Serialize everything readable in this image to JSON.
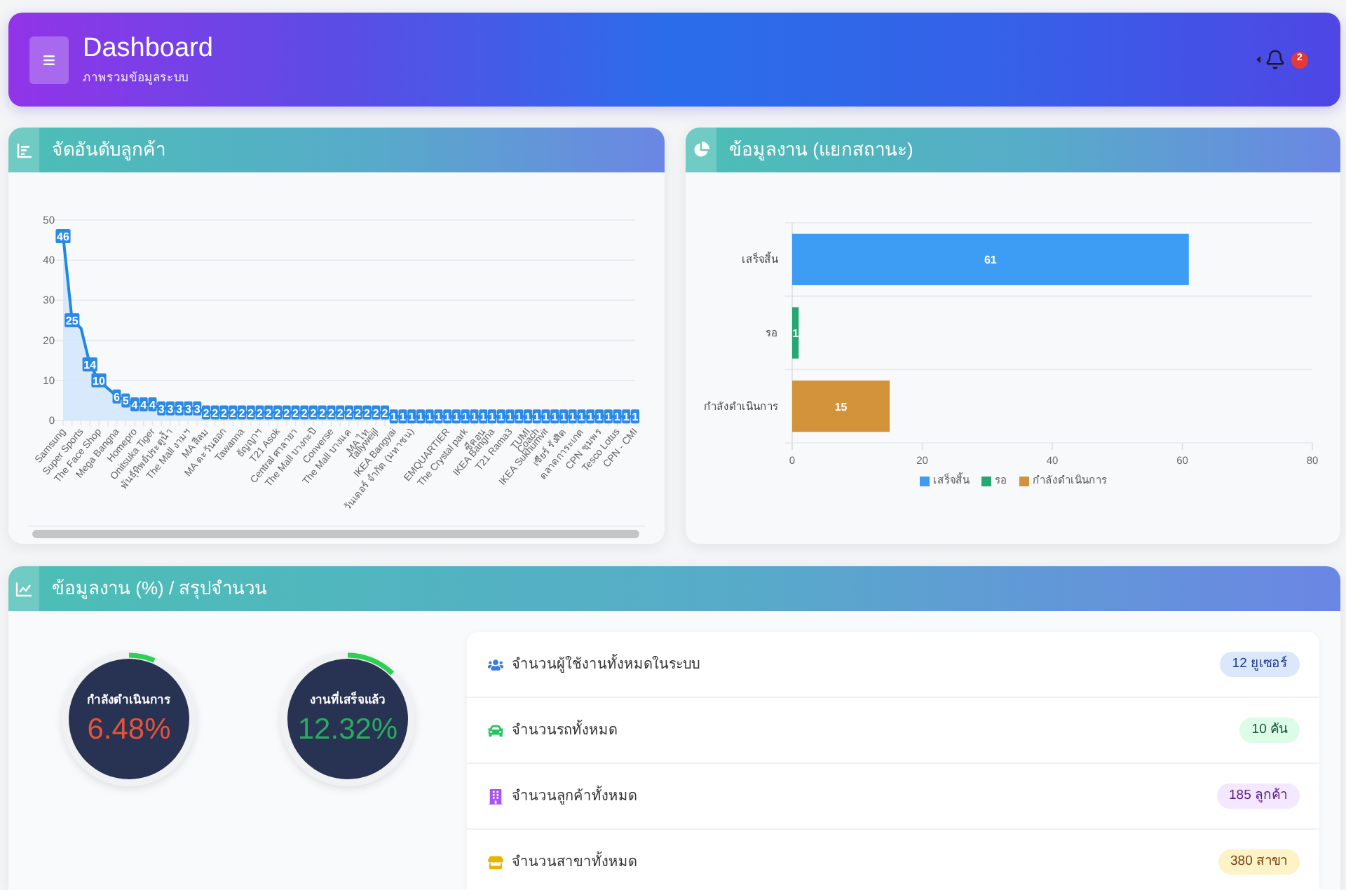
{
  "header": {
    "title": "Dashboard",
    "subtitle": "ภาพรวมข้อมูลระบบ",
    "notification_count": "2"
  },
  "customer_ranking": {
    "title": "จัดอันดับลูกค้า",
    "chart_data": {
      "type": "area",
      "categories": [
        "Samsung",
        null,
        "Super Sports",
        null,
        "The Face Shop",
        null,
        "Mega Bangna",
        null,
        "Homepro",
        null,
        "Onitsuka Tiger",
        null,
        "พันธุ์ทิพย์ประตูน้ำ",
        null,
        "The Mall งามฯ",
        null,
        "MA สีลม",
        null,
        "MA ตะวันออก",
        null,
        "Tawanna",
        null,
        "ธัญญาฯ",
        null,
        "T21 Asok",
        null,
        "Central ศาลายา",
        null,
        "The Mall บางกะปิ",
        null,
        "Converse",
        null,
        "The Mall บางแค",
        null,
        "MA ไท",
        "Tallyweijl",
        null,
        "IKEA Bangyai",
        null,
        "วันเดอร์ จำกัด (มหาชน)",
        null,
        null,
        null,
        "EMQUARTIER",
        null,
        "The Crystal park",
        null,
        "ซีคอน",
        "IKEA Bangna",
        null,
        "T21 Rama3",
        null,
        "TUMI",
        "Coach",
        "IKEA Sukhumvit",
        null,
        "เซียร์ รังสิต",
        null,
        "ตลาดการะเกด",
        null,
        "CPN ชุมพร",
        null,
        "Tesco Lotus",
        null,
        "CPN - CMI"
      ],
      "values": [
        46,
        25,
        23,
        14,
        10,
        8,
        6,
        5,
        4,
        4,
        4,
        3,
        3,
        3,
        3,
        3,
        2,
        2,
        2,
        2,
        2,
        2,
        2,
        2,
        2,
        2,
        2,
        2,
        2,
        2,
        2,
        2,
        2,
        2,
        2,
        2,
        2,
        1,
        1,
        1,
        1,
        1,
        1,
        1,
        1,
        1,
        1,
        1,
        1,
        1,
        1,
        1,
        1,
        1,
        1,
        1,
        1,
        1,
        1,
        1,
        1,
        1,
        1,
        1,
        1
      ],
      "ylim": [
        0,
        50
      ],
      "yticks": [
        0,
        10,
        20,
        30,
        40,
        50
      ],
      "grid": true,
      "value_labels": [
        "46",
        "25",
        null,
        "14",
        "10",
        null,
        "6",
        "5",
        "4",
        "4",
        "4",
        "3",
        "3",
        "3",
        "3",
        "3",
        "2",
        "2",
        "2",
        "2",
        "2",
        "2",
        "2",
        "2",
        "2",
        "2",
        "2",
        "2",
        "2",
        "2",
        "2",
        "2",
        "2",
        "2",
        "2",
        "2",
        "2",
        "1",
        "1",
        "1",
        "1",
        "1",
        "1",
        "1",
        "1",
        "1",
        "1",
        "1",
        "1",
        "1",
        "1",
        "1",
        "1",
        "1",
        "1",
        "1",
        "1",
        "1",
        "1",
        "1",
        "1",
        "1",
        "1",
        "1",
        "1"
      ]
    }
  },
  "job_status": {
    "title": "ข้อมูลงาน (แยกสถานะ)",
    "chart_data": {
      "type": "bar",
      "orientation": "horizontal",
      "stacked": true,
      "categories": [
        "เสร็จสิ้น",
        "รอ",
        "กำลังดำเนินการ"
      ],
      "series": [
        {
          "name": "เสร็จสิ้น",
          "color": "#3d9df5",
          "values": [
            61,
            null,
            null
          ]
        },
        {
          "name": "รอ",
          "color": "#24a874",
          "values": [
            null,
            1,
            null
          ]
        },
        {
          "name": "กำลังดำเนินการ",
          "color": "#d2933a",
          "values": [
            null,
            null,
            15
          ]
        }
      ],
      "xlim": [
        0,
        80
      ],
      "xticks": [
        0,
        20,
        40,
        60,
        80
      ],
      "grid": true,
      "legend": "bottom",
      "data_labels": true
    }
  },
  "summary": {
    "title": "ข้อมูลงาน (%) / สรุปจำนวน",
    "gauges": [
      {
        "label": "กำลังดำเนินการ",
        "value": "6.48%",
        "level": 0.0648,
        "color": "#e5533d"
      },
      {
        "label": "งานที่เสร็จแล้ว",
        "value": "12.32%",
        "level": 0.1232,
        "color": "#2bab62"
      }
    ],
    "stats": [
      {
        "kind": "users",
        "label": "จำนวนผู้ใช้งานทั้งหมดในระบบ",
        "count": "12 ยูเซอร์"
      },
      {
        "kind": "car",
        "label": "จำนวนรถทั้งหมด",
        "count": "10 คัน"
      },
      {
        "kind": "building",
        "label": "จำนวนลูกค้าทั้งหมด",
        "count": "185 ลูกค้า"
      },
      {
        "kind": "store",
        "label": "จำนวนสาขาทั้งหมด",
        "count": "380 สาขา"
      }
    ]
  }
}
